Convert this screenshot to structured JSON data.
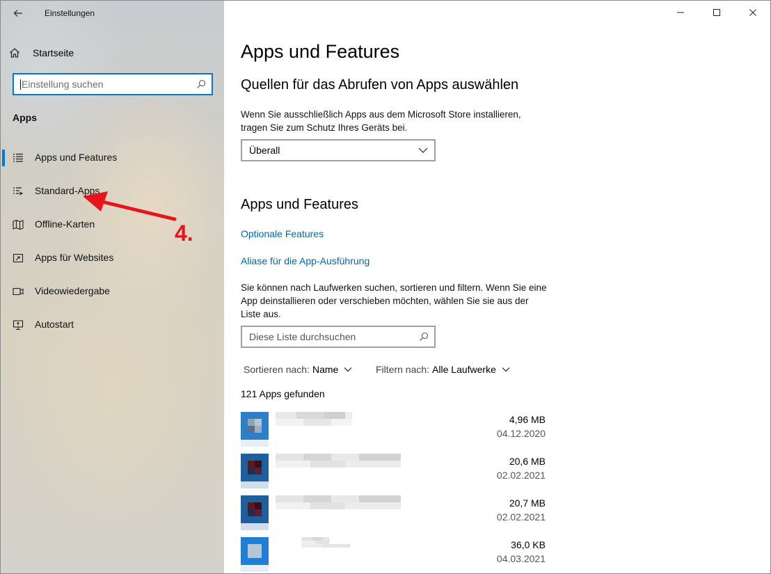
{
  "window": {
    "title": "Einstellungen"
  },
  "sidebar": {
    "home_label": "Startseite",
    "search_placeholder": "Einstellung suchen",
    "section_title": "Apps",
    "items": [
      {
        "label": "Apps und Features",
        "icon": "apps-features-icon",
        "selected": true
      },
      {
        "label": "Standard-Apps",
        "icon": "default-apps-icon",
        "selected": false
      },
      {
        "label": "Offline-Karten",
        "icon": "map-icon",
        "selected": false
      },
      {
        "label": "Apps für Websites",
        "icon": "web-apps-icon",
        "selected": false
      },
      {
        "label": "Videowiedergabe",
        "icon": "video-icon",
        "selected": false
      },
      {
        "label": "Autostart",
        "icon": "startup-icon",
        "selected": false
      }
    ]
  },
  "annotation": {
    "label": "4.",
    "color": "#e8141b"
  },
  "content": {
    "title": "Apps und Features",
    "sources": {
      "heading": "Quellen für das Abrufen von Apps auswählen",
      "description_line1": "Wenn Sie ausschließlich Apps aus dem Microsoft Store installieren,",
      "description_line2": "tragen Sie zum Schutz Ihres Geräts bei.",
      "dropdown_value": "Überall"
    },
    "apps": {
      "heading": "Apps und Features",
      "link_optional": "Optionale Features",
      "link_alias": "Aliase für die App-Ausführung",
      "description_line1": "Sie können nach Laufwerken suchen, sortieren und filtern. Wenn Sie eine",
      "description_line2": "App deinstallieren oder verschieben möchten, wählen Sie sie aus der",
      "description_line3": "Liste aus.",
      "search_placeholder": "Diese Liste durchsuchen",
      "sort_label": "Sortieren nach:",
      "sort_value": "Name",
      "filter_label": "Filtern nach:",
      "filter_value": "Alle Laufwerke",
      "count_text": "121 Apps gefunden",
      "list": [
        {
          "size": "4,96 MB",
          "date": "04.12.2020"
        },
        {
          "size": "20,6 MB",
          "date": "02.02.2021"
        },
        {
          "size": "20,7 MB",
          "date": "02.02.2021"
        },
        {
          "size": "36,0 KB",
          "date": "04.03.2021"
        }
      ]
    }
  },
  "colors": {
    "accent": "#0078d7",
    "link": "#0067b8"
  }
}
